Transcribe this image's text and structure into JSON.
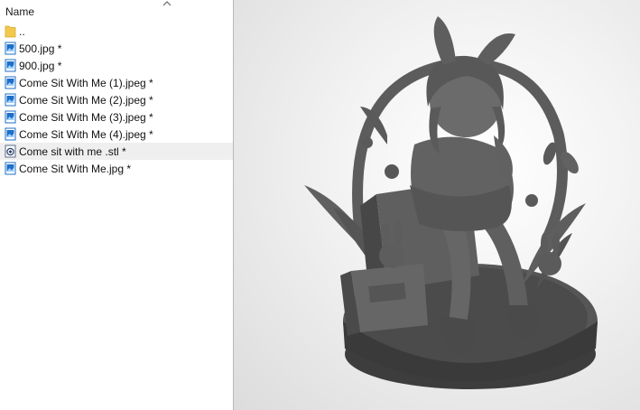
{
  "file_list": {
    "column_header": "Name",
    "items": [
      {
        "name": "..",
        "type": "folder"
      },
      {
        "name": "500.jpg *",
        "type": "image"
      },
      {
        "name": "900.jpg *",
        "type": "image"
      },
      {
        "name": "Come Sit With Me (1).jpeg *",
        "type": "image"
      },
      {
        "name": "Come Sit With Me (2).jpeg *",
        "type": "image"
      },
      {
        "name": "Come Sit With Me (3).jpeg *",
        "type": "image"
      },
      {
        "name": "Come Sit With Me (4).jpeg *",
        "type": "image"
      },
      {
        "name": "Come sit with me .stl *",
        "type": "stl",
        "highlighted": true
      },
      {
        "name": "Come Sit With Me.jpg *",
        "type": "image"
      }
    ]
  },
  "icons": {
    "folder": "folder-icon",
    "image": "image-file-icon",
    "stl": "3d-model-file-icon",
    "sort": "chevron-up-icon"
  },
  "colors": {
    "model_gray": "#585858",
    "highlight_row": "#efefef",
    "image_icon_blue": "#1e6fc8",
    "folder_yellow": "#f2c94c"
  }
}
